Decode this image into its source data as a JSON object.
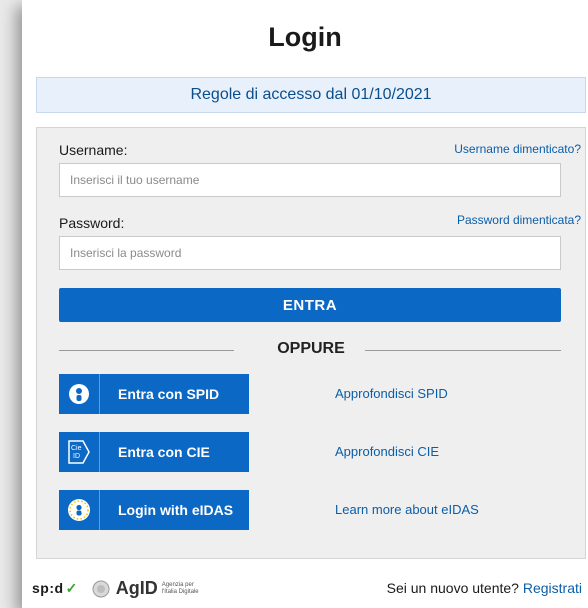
{
  "page": {
    "title": "Login"
  },
  "notice": {
    "label": "Regole di accesso dal 01/10/2021"
  },
  "form": {
    "username": {
      "label": "Username:",
      "forgot_link": "Username dimenticato?",
      "placeholder": "Inserisci il tuo username",
      "value": ""
    },
    "password": {
      "label": "Password:",
      "forgot_link": "Password dimenticata?",
      "placeholder": "Inserisci la password",
      "value": ""
    },
    "submit_label": "ENTRA",
    "divider_label": "OPPURE"
  },
  "auth_options": [
    {
      "button_label": "Entra con SPID",
      "icon": "user-icon",
      "more_link": "Approfondisci SPID"
    },
    {
      "button_label": "Entra con CIE",
      "icon": "cie-id-icon",
      "icon_text": "Cie ID",
      "more_link": "Approfondisci CIE"
    },
    {
      "button_label": "Login with eIDAS",
      "icon": "eidas-icon",
      "more_link": "Learn more about eIDAS"
    }
  ],
  "footer": {
    "spid_logo": "sp:d",
    "agid_logo": "AgID",
    "agid_subtitle": "Agenzia per l'Italia Digitale",
    "new_user_text": "Sei un nuovo utente?",
    "register_link": "Registrati"
  },
  "colors": {
    "primary": "#0b68c4",
    "link": "#0b5ea8",
    "notice_bg": "#e8f1fb",
    "form_bg": "#efefef"
  }
}
